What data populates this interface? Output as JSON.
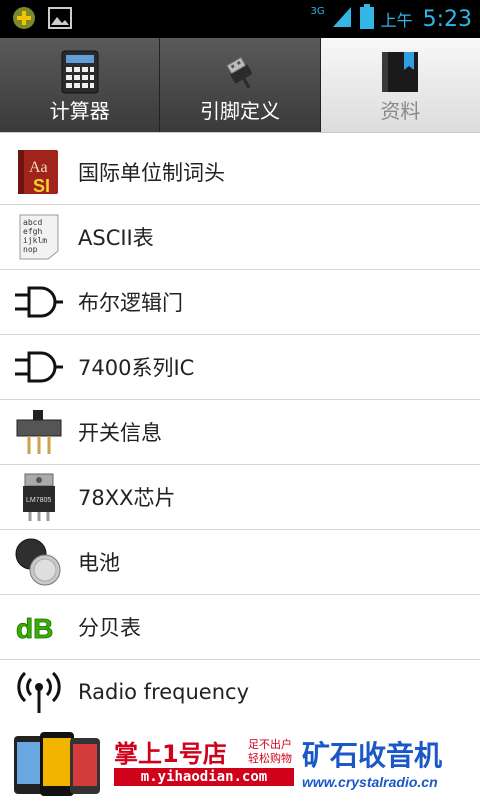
{
  "status": {
    "network": "3G",
    "ampm": "上午",
    "time": "5:23"
  },
  "tabs": [
    {
      "label": "计算器",
      "icon": "calculator-icon",
      "active": false
    },
    {
      "label": "引脚定义",
      "icon": "usb-plug-icon",
      "active": false
    },
    {
      "label": "资料",
      "icon": "bookmark-book-icon",
      "active": true
    }
  ],
  "list": [
    {
      "label": "国际单位制词头",
      "icon": "dictionary-si-icon"
    },
    {
      "label": "ASCII表",
      "icon": "ascii-table-icon"
    },
    {
      "label": "布尔逻辑门",
      "icon": "logic-gate-icon"
    },
    {
      "label": "7400系列IC",
      "icon": "logic-gate-icon"
    },
    {
      "label": "开关信息",
      "icon": "slide-switch-icon"
    },
    {
      "label": "78XX芯片",
      "icon": "voltage-regulator-icon"
    },
    {
      "label": "电池",
      "icon": "coin-battery-icon"
    },
    {
      "label": "分贝表",
      "icon": "decibel-icon"
    },
    {
      "label": "Radio frequency",
      "icon": "antenna-icon"
    }
  ],
  "ad": {
    "shop_title": "掌上1号店",
    "shop_slogan1": "足不出户",
    "shop_slogan2": "轻松购物",
    "shop_url": "m.yihaodian.com",
    "radio_title": "矿石收音机",
    "radio_url": "www.crystalradio.cn"
  },
  "colors": {
    "accent": "#33b5e5",
    "tab_bg": "#444444",
    "tab_active_bg": "#e8e8e8",
    "ad_red": "#d0021b",
    "ad_blue": "#1a57c7"
  }
}
